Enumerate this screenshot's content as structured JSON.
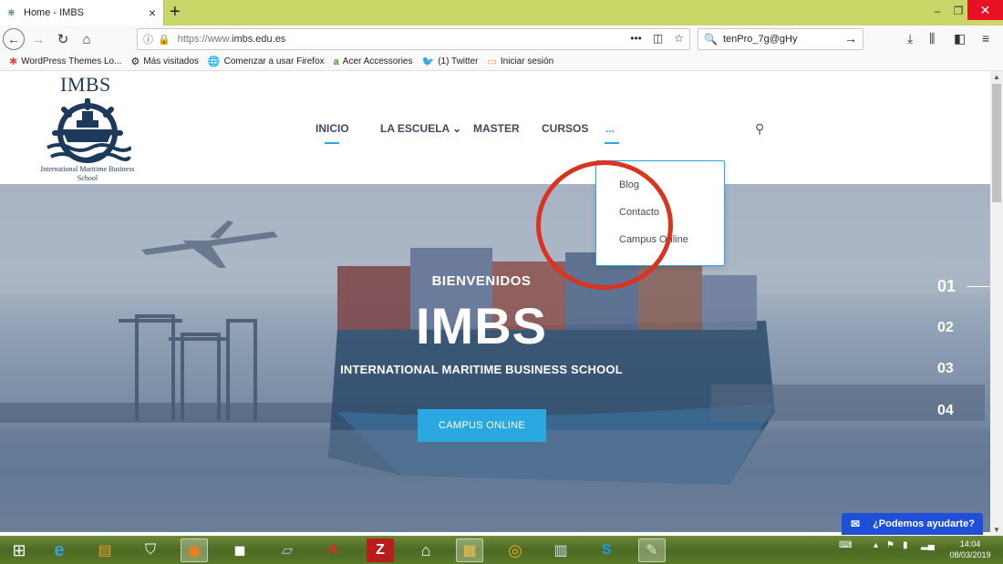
{
  "browser": {
    "tab_title": "Home - IMBS",
    "tab_close": "×",
    "new_tab": "+",
    "url_prefix": "https://www.",
    "url_main": "imbs.edu.es",
    "search_value": "tenPro_7g@gHy",
    "window": {
      "minimize": "‒",
      "maximize": "❐",
      "close": "✕"
    }
  },
  "bookmarks": [
    {
      "icon": "✱",
      "label": "WordPress Themes Lo..."
    },
    {
      "icon": "⚙",
      "label": "Más visitados"
    },
    {
      "icon": "🌐",
      "label": "Comenzar a usar Firefox"
    },
    {
      "icon": "a",
      "label": "Acer Accessories"
    },
    {
      "icon": "🐦",
      "label": "(1) Twitter"
    },
    {
      "icon": "▭",
      "label": "Iniciar sesión"
    }
  ],
  "site": {
    "logo_text": "IMBS",
    "logo_sub": "International Maritime Business School",
    "menu": {
      "inicio": "INICIO",
      "escuela": "LA ESCUELA",
      "escuela_caret": "⌄",
      "master": "MASTER",
      "cursos": "CURSOS",
      "more": "..."
    },
    "dropdown": [
      "Blog",
      "Contacto",
      "Campus Online"
    ]
  },
  "hero": {
    "welcome": "BIENVENIDOS",
    "title": "IMBS",
    "subtitle": "INTERNATIONAL MARITIME BUSINESS SCHOOL",
    "button": "CAMPUS ONLINE",
    "slides": [
      "01",
      "02",
      "03",
      "04"
    ]
  },
  "chat": {
    "label": "¿Podemos ayudarte?"
  },
  "taskbar": {
    "time": "14:04",
    "date": "08/03/2019"
  },
  "colors": {
    "accent": "#2ba8e0",
    "annotation": "#d9341f",
    "brand": "#1d3a5c",
    "taskbar": "#5a7a2a"
  }
}
